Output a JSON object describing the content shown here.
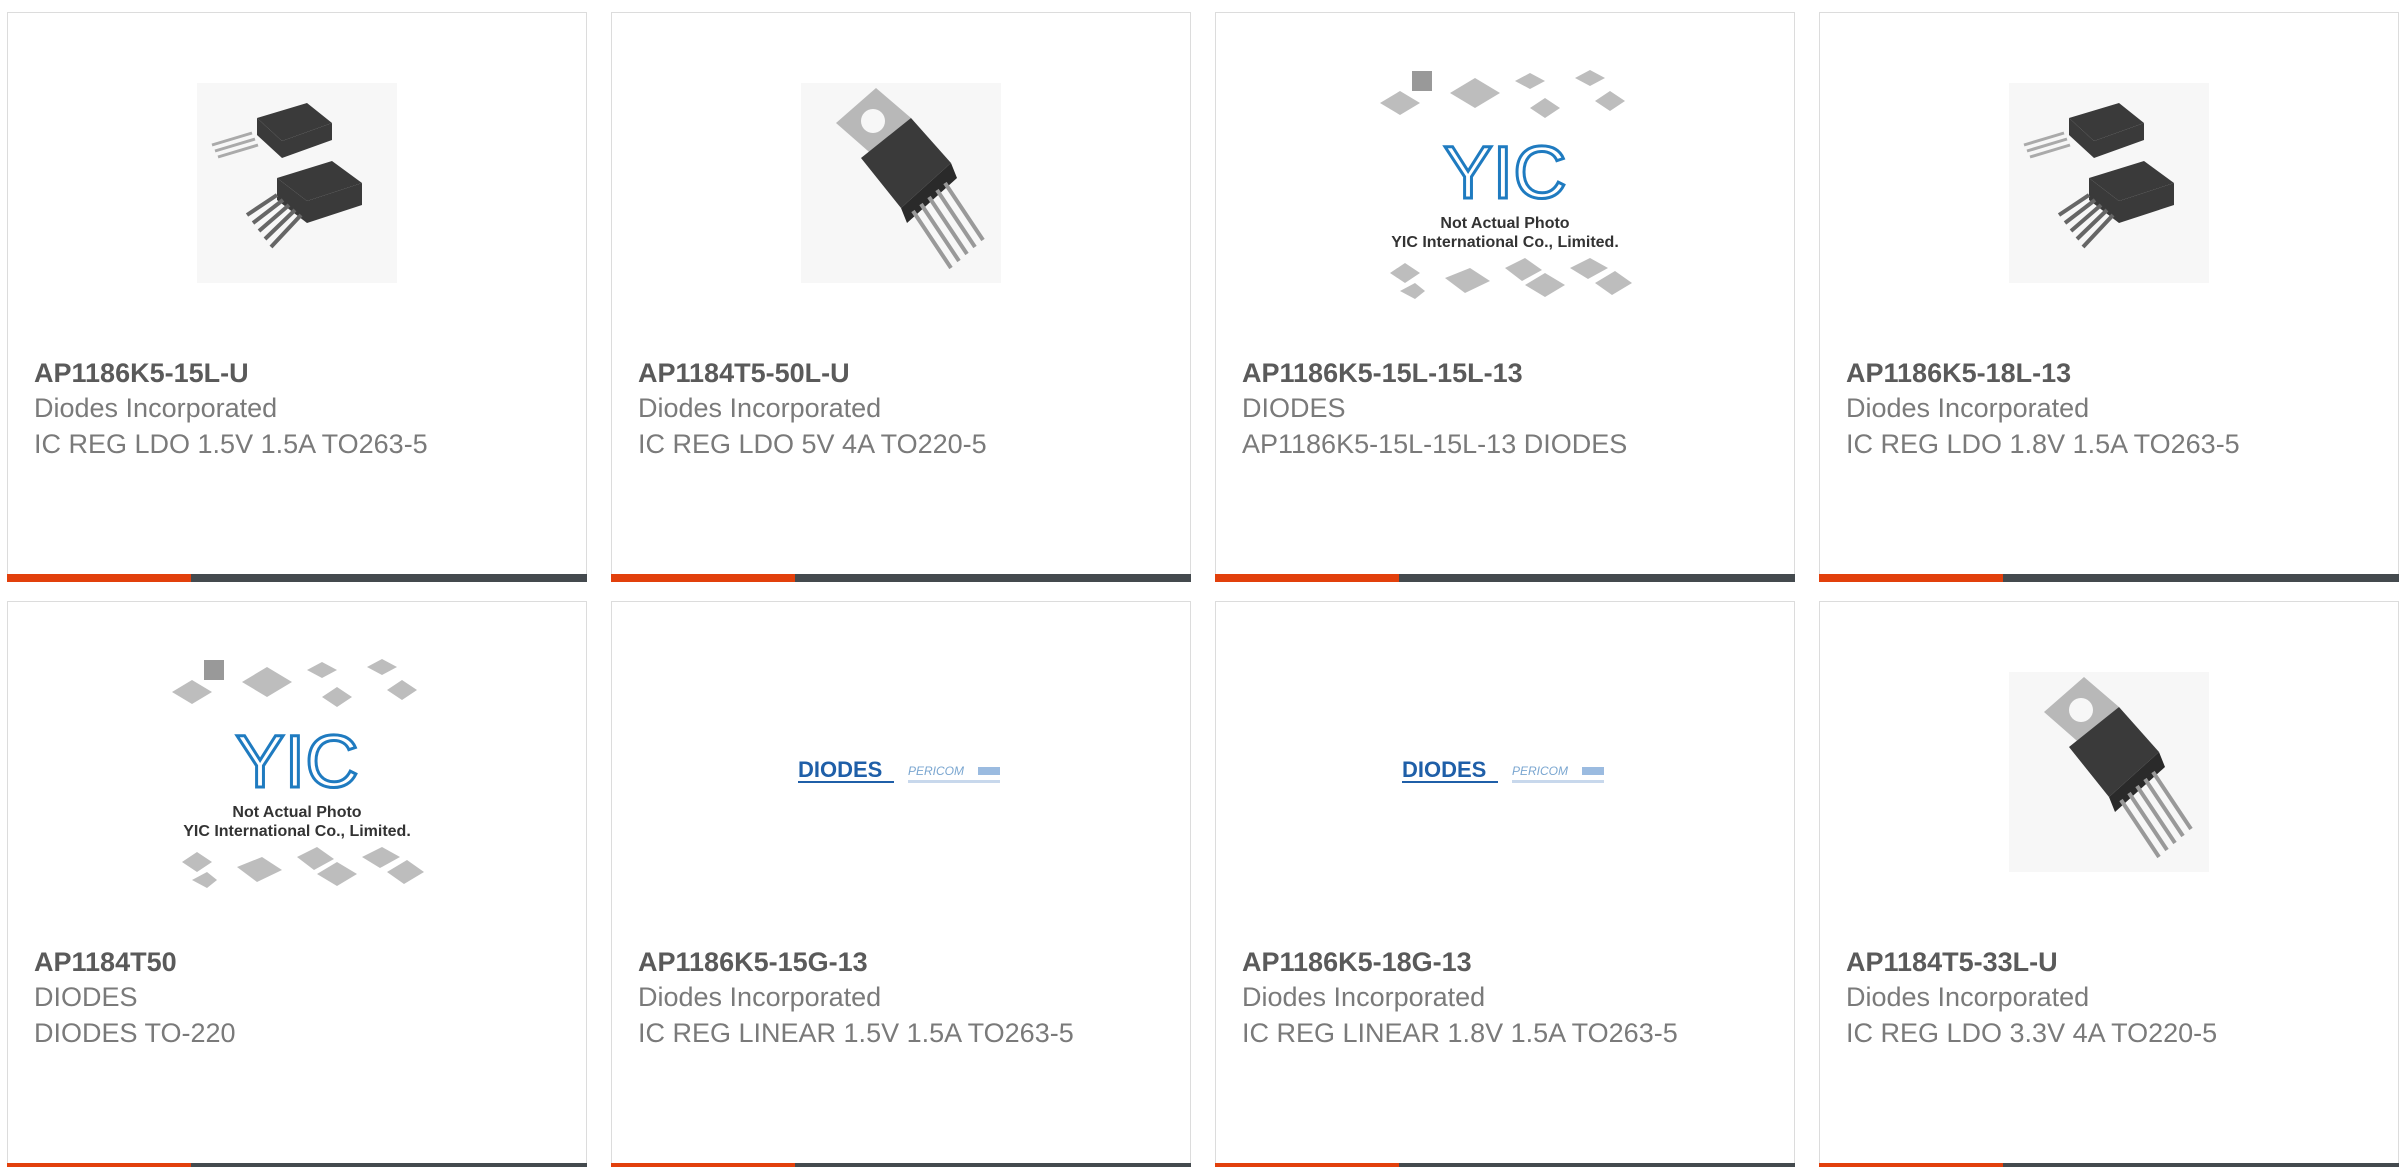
{
  "colors": {
    "accent": "#e2400c",
    "bar": "#444a4e",
    "part": "#5a5a5a",
    "text": "#7a7a7a",
    "diodes_blue": "#1f5fa8",
    "yic_blue": "#1f7bc0"
  },
  "placeholder": {
    "line1": "Not Actual Photo",
    "line2": "YIC International Co., Limited.",
    "logo": "YIC"
  },
  "brand": {
    "diodes": "DIODES",
    "pericom": "PERICOM"
  },
  "products": [
    {
      "part": "AP1186K5-15L-U",
      "manufacturer": "Diodes Incorporated",
      "description": "IC REG LDO 1.5V 1.5A TO263-5",
      "image": "to263-package"
    },
    {
      "part": "AP1184T5-50L-U",
      "manufacturer": "Diodes Incorporated",
      "description": "IC REG LDO 5V 4A TO220-5",
      "image": "to220-package"
    },
    {
      "part": "AP1186K5-15L-15L-13",
      "manufacturer": "DIODES",
      "description": "AP1186K5-15L-15L-13 DIODES",
      "image": "not-actual-photo"
    },
    {
      "part": "AP1186K5-18L-13",
      "manufacturer": "Diodes Incorporated",
      "description": "IC REG LDO 1.8V 1.5A TO263-5",
      "image": "to263-package"
    },
    {
      "part": "AP1184T50",
      "manufacturer": "DIODES",
      "description": "DIODES TO-220",
      "image": "not-actual-photo"
    },
    {
      "part": "AP1186K5-15G-13",
      "manufacturer": "Diodes Incorporated",
      "description": "IC REG LINEAR 1.5V 1.5A TO263-5",
      "image": "diodes-pericom-logo"
    },
    {
      "part": "AP1186K5-18G-13",
      "manufacturer": "Diodes Incorporated",
      "description": "IC REG LINEAR 1.8V 1.5A TO263-5",
      "image": "diodes-pericom-logo"
    },
    {
      "part": "AP1184T5-33L-U",
      "manufacturer": "Diodes Incorporated",
      "description": "IC REG LDO 3.3V 4A TO220-5",
      "image": "to220-package"
    }
  ]
}
